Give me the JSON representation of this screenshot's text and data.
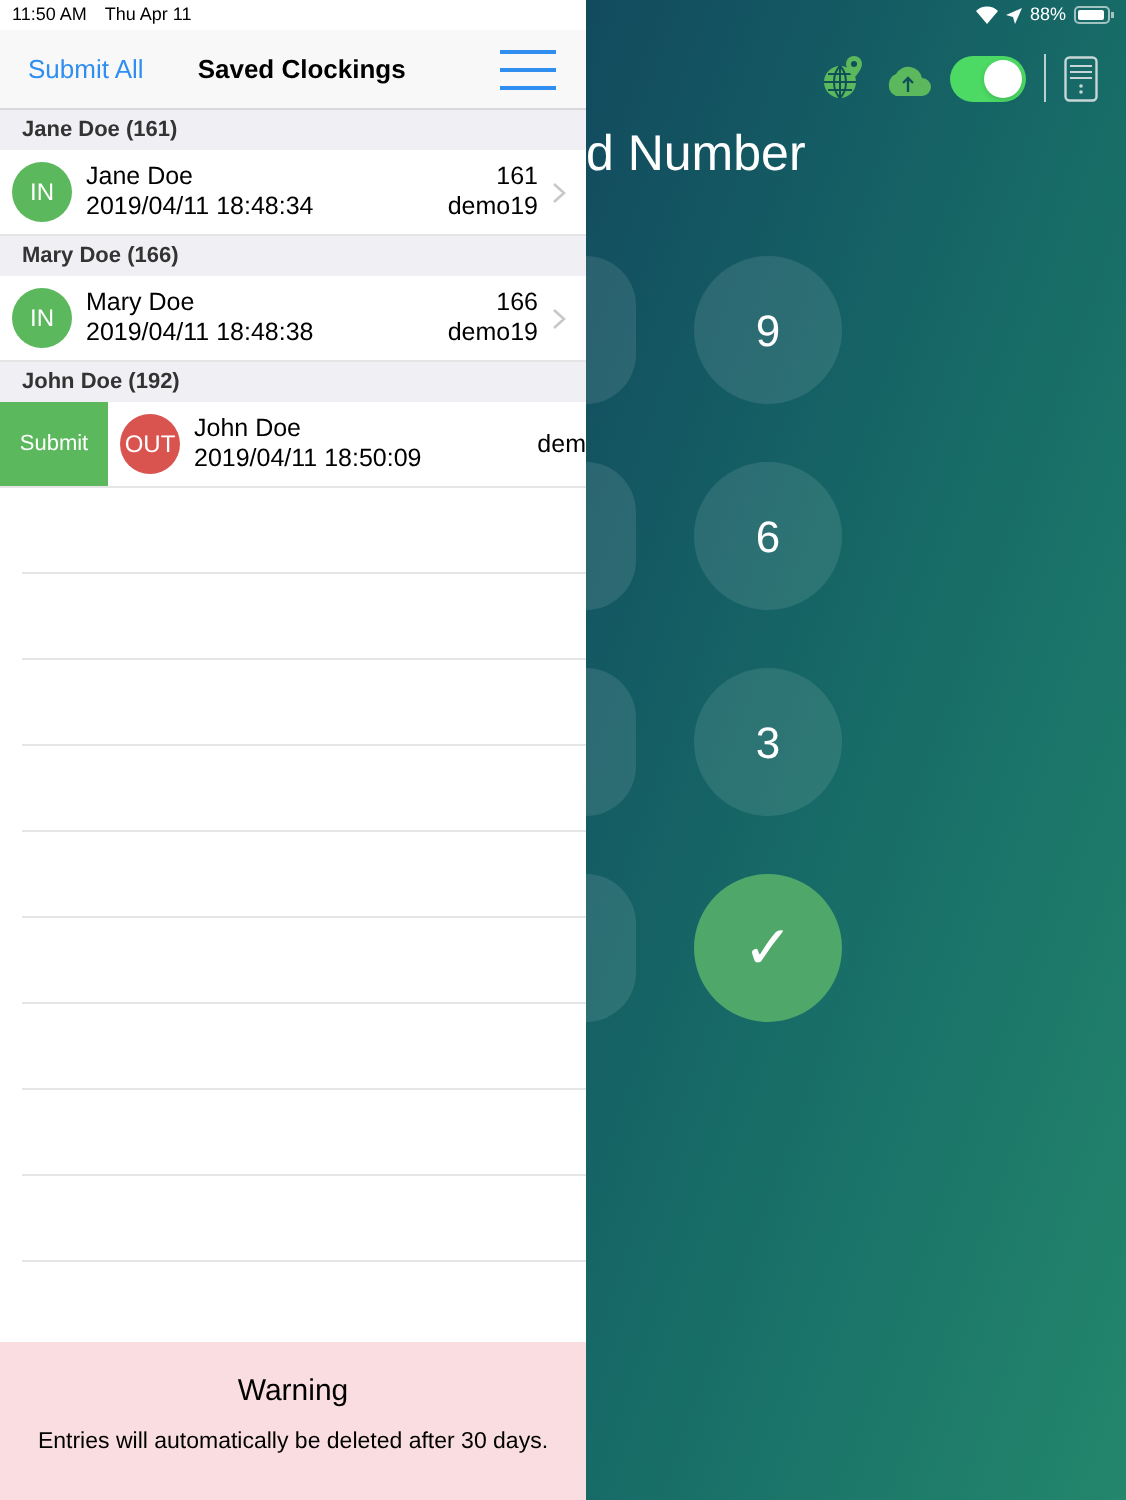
{
  "status_bar": {
    "time": "11:50 AM",
    "date": "Thu Apr 11",
    "battery": "88%"
  },
  "nav": {
    "left_button": "Submit All",
    "title": "Saved Clockings"
  },
  "groups": [
    {
      "header": "Jane Doe (161)",
      "item": {
        "badge": "IN",
        "kind": "in",
        "name": "Jane Doe",
        "datetime": "2019/04/11 18:48:34",
        "number": "161",
        "site": "demo19",
        "swiped": false
      }
    },
    {
      "header": "Mary Doe (166)",
      "item": {
        "badge": "IN",
        "kind": "in",
        "name": "Mary Doe",
        "datetime": "2019/04/11 18:48:38",
        "number": "166",
        "site": "demo19",
        "swiped": false
      }
    },
    {
      "header": "John Doe (192)",
      "item": {
        "badge": "OUT",
        "kind": "out",
        "name": "John Doe",
        "datetime": "2019/04/11 18:50:09",
        "site": "dem",
        "swiped": true,
        "action": "Submit"
      }
    }
  ],
  "warning": {
    "title": "Warning",
    "text": "Entries will automatically be deleted after 30 days."
  },
  "keypad": {
    "title": "d Number",
    "sync_on": true,
    "keys": [
      "9",
      "6",
      "3",
      "✓"
    ]
  }
}
